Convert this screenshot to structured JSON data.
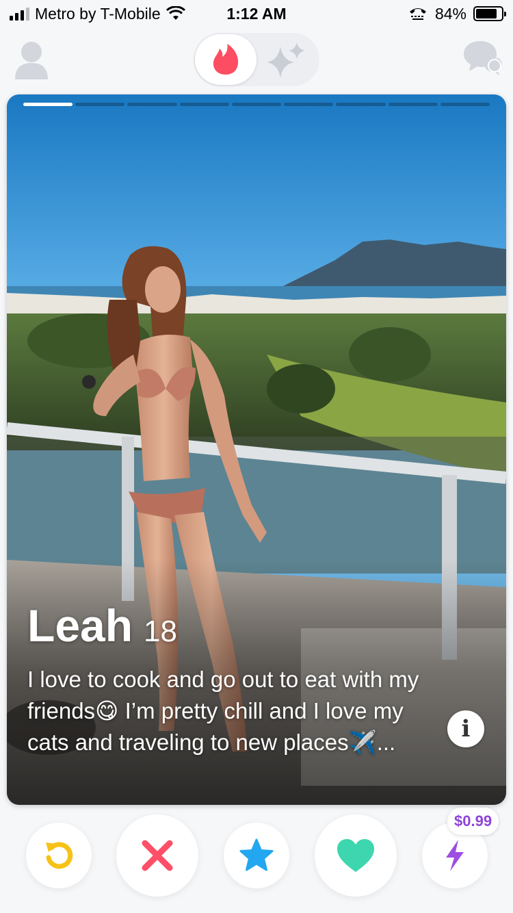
{
  "status_bar": {
    "carrier": "Metro by T-Mobile",
    "time": "1:12 AM",
    "battery_text": "84%",
    "battery_level": 0.84
  },
  "top_nav": {
    "profile_icon": "person-icon",
    "discover_icon": "flame-icon",
    "gold_icon": "sparkles-icon",
    "messages_icon": "chat-bubbles-icon"
  },
  "card": {
    "photo_count": 9,
    "current_photo": 1,
    "name": "Leah",
    "age": "18",
    "bio": "I love to cook and go out to eat with my friends😋 I’m pretty chill and I love my cats and traveling to new places✈️...",
    "info_label": "i"
  },
  "actions": {
    "rewind_icon": "rewind-icon",
    "nope_icon": "x-icon",
    "super_like_icon": "star-icon",
    "like_icon": "heart-icon",
    "boost_icon": "lightning-icon",
    "boost_price": "$0.99"
  },
  "colors": {
    "flame": "#fd4d63",
    "rewind": "#f7c218",
    "nope": "#fd4f68",
    "super_like": "#23a7f0",
    "like": "#3dd6ae",
    "boost": "#9c4fe0",
    "icon_gray": "#d3d6dc"
  }
}
